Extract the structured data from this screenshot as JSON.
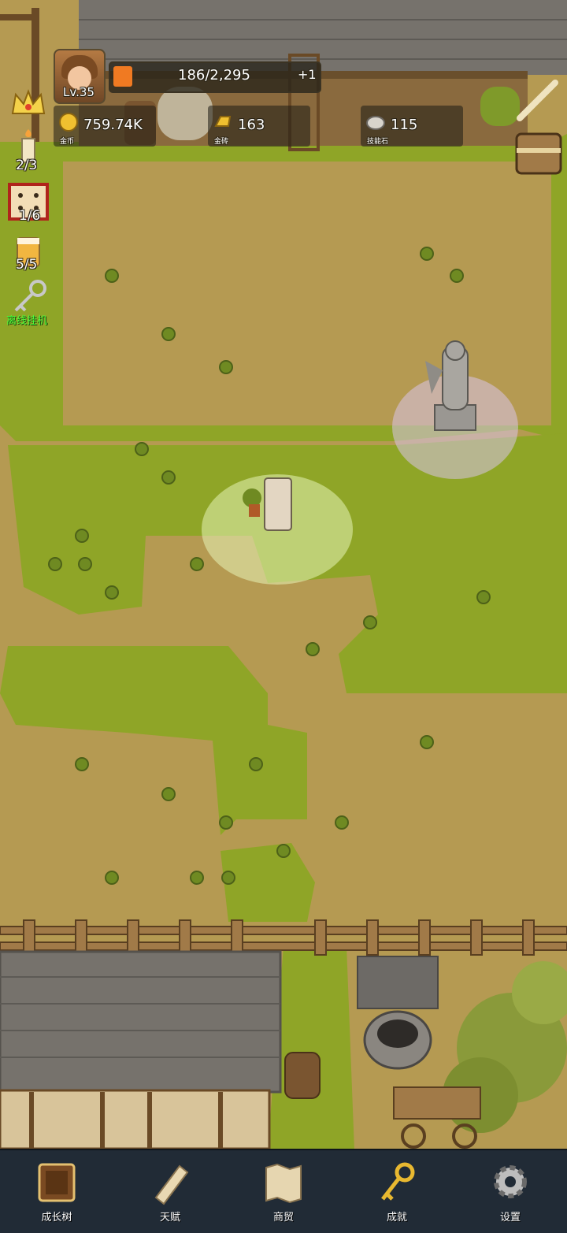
{
  "player": {
    "level": "Lv.35",
    "xp_text": "186/2,295",
    "xp_fraction": 0.081,
    "xp_bonus": "+1"
  },
  "resources": [
    {
      "icon": "gold-coin-icon",
      "value": "759.74K",
      "label": "金币"
    },
    {
      "icon": "gold-bar-icon",
      "value": "163",
      "label": "金砖"
    },
    {
      "icon": "skill-stone-icon",
      "value": "115",
      "label": "技能石"
    }
  ],
  "side": {
    "candle_count": "2/3",
    "dice_count": "1/6",
    "beer_count": "5/5",
    "idle_label": "离线挂机"
  },
  "nav": [
    {
      "icon": "growth-tree-book-icon",
      "label": "成长树"
    },
    {
      "icon": "talent-scroll-icon",
      "label": "天赋"
    },
    {
      "icon": "trade-map-icon",
      "label": "商贸"
    },
    {
      "icon": "achievement-key-icon",
      "label": "成就"
    },
    {
      "icon": "settings-gear-icon",
      "label": "设置"
    }
  ],
  "colors": {
    "grass": "#8fa527",
    "dirt": "#b59a52",
    "xp_fill": "#f07a22",
    "navbar": "#212b36",
    "idle_text": "#4cff3a"
  }
}
